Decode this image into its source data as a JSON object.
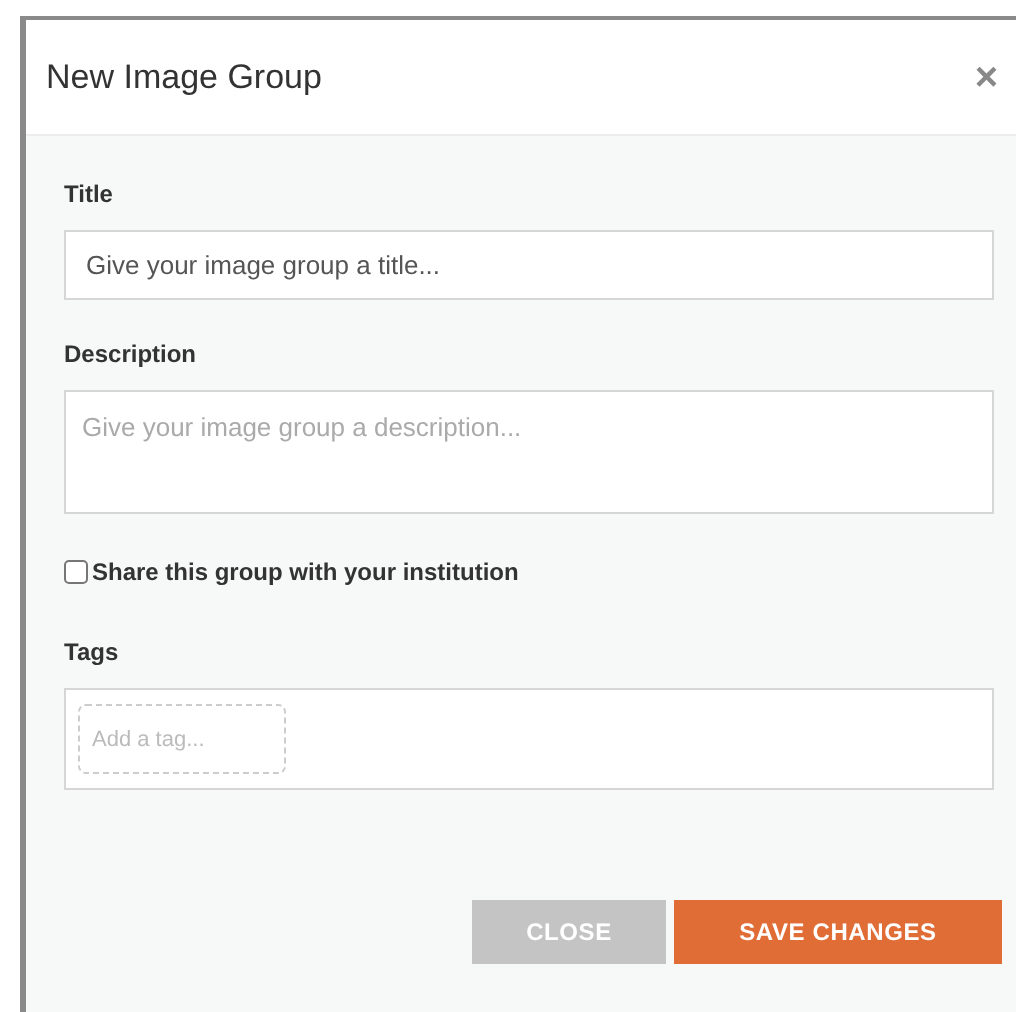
{
  "dialog": {
    "title": "New Image Group",
    "close_icon": "×"
  },
  "fields": [
    {
      "kind": "input",
      "label": "Title",
      "placeholder": "Give your image group a title..."
    },
    {
      "kind": "textarea",
      "label": "Description",
      "placeholder": "Give your image group a description..."
    }
  ],
  "share": {
    "label": "Share this group with your institution",
    "checked": false
  },
  "tags": {
    "label": "Tags",
    "placeholder": "Add a tag..."
  },
  "buttons": [
    {
      "kind": "secondary",
      "label": "CLOSE"
    },
    {
      "kind": "primary",
      "label": "SAVE CHANGES"
    }
  ]
}
